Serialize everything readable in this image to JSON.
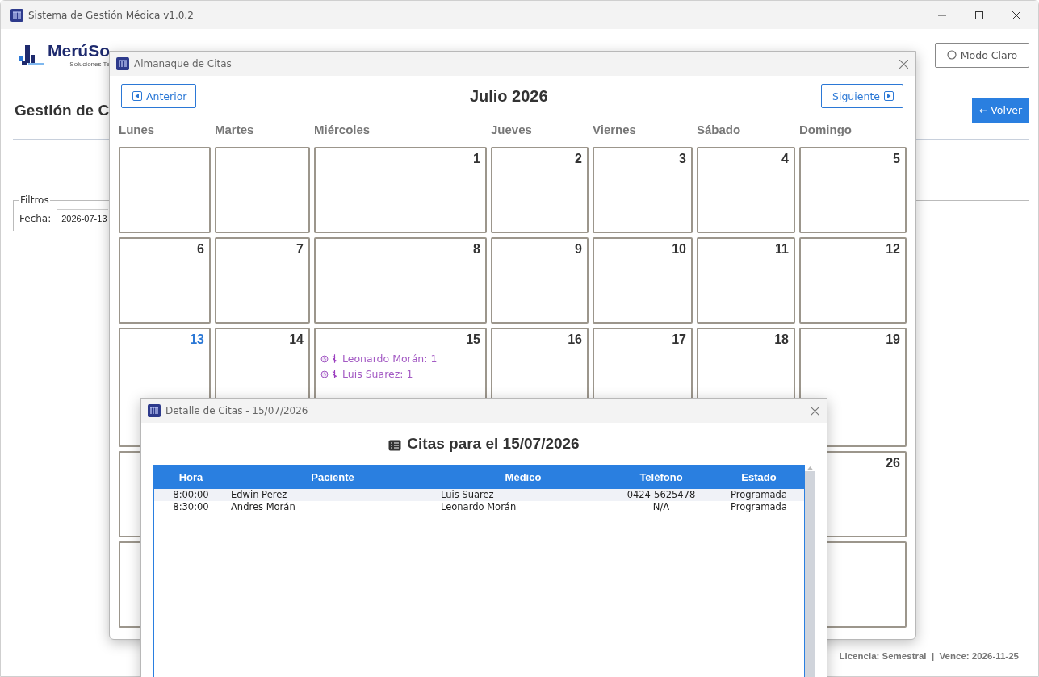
{
  "main_window": {
    "title": "Sistema de Gestión Médica v1.0.2",
    "logo": "MerúSo",
    "logo_tagline": "Soluciones Te",
    "theme_button": "Modo Claro",
    "page_title": "Gestión de C",
    "back_button": "← Volver",
    "filters": {
      "legend": "Filtros",
      "date_label": "Fecha:",
      "date_value": "2026-07-13"
    },
    "license": "Licencia: Semestral  |  Vence: 2026-11-25"
  },
  "calendar_window": {
    "title": "Almanaque de Citas",
    "prev_button": "Anterior",
    "next_button": "Siguiente",
    "month": "Julio 2026",
    "weekdays": [
      "Lunes",
      "Martes",
      "Miércoles",
      "Jueves",
      "Viernes",
      "Sábado",
      "Domingo"
    ],
    "weeks": [
      [
        {
          "kind": "blank"
        },
        {
          "kind": "blank"
        },
        {
          "kind": "day",
          "day": "1",
          "today": false
        },
        {
          "kind": "day",
          "day": "2",
          "today": false
        },
        {
          "kind": "day",
          "day": "3",
          "today": false
        },
        {
          "kind": "day",
          "day": "4",
          "today": false
        },
        {
          "kind": "day",
          "day": "5",
          "today": false
        }
      ],
      [
        {
          "kind": "day",
          "day": "6",
          "today": false
        },
        {
          "kind": "day",
          "day": "7",
          "today": false
        },
        {
          "kind": "day",
          "day": "8",
          "today": false
        },
        {
          "kind": "day",
          "day": "9",
          "today": false
        },
        {
          "kind": "day",
          "day": "10",
          "today": false
        },
        {
          "kind": "day",
          "day": "11",
          "today": false
        },
        {
          "kind": "day",
          "day": "12",
          "today": false
        }
      ],
      [
        {
          "kind": "day",
          "day": "13",
          "today": true
        },
        {
          "kind": "day",
          "day": "14",
          "today": false
        },
        {
          "kind": "day",
          "day": "15",
          "today": false,
          "events": [
            "Leonardo Morán: 1",
            "Luis Suarez: 1"
          ]
        },
        {
          "kind": "day",
          "day": "16",
          "today": false
        },
        {
          "kind": "day",
          "day": "17",
          "today": false
        },
        {
          "kind": "day",
          "day": "18",
          "today": false
        },
        {
          "kind": "day",
          "day": "19",
          "today": false
        }
      ],
      [
        {
          "kind": "blank"
        },
        {
          "kind": "day",
          "day": "26",
          "today": false
        }
      ],
      [
        {
          "kind": "blank"
        },
        {
          "kind": "blank"
        }
      ]
    ]
  },
  "detail_window": {
    "title": "Detalle de Citas - 15/07/2026",
    "heading": "Citas para el 15/07/2026",
    "table": {
      "columns": [
        "Hora",
        "Paciente",
        "Médico",
        "Teléfono",
        "Estado"
      ],
      "rows": [
        [
          "8:00:00",
          "Edwin Perez",
          "Luis Suarez",
          "0424-5625478",
          "Programada"
        ],
        [
          "8:30:00",
          "Andres Morán",
          "Leonardo Morán",
          "N/A",
          "Programada"
        ]
      ]
    }
  }
}
